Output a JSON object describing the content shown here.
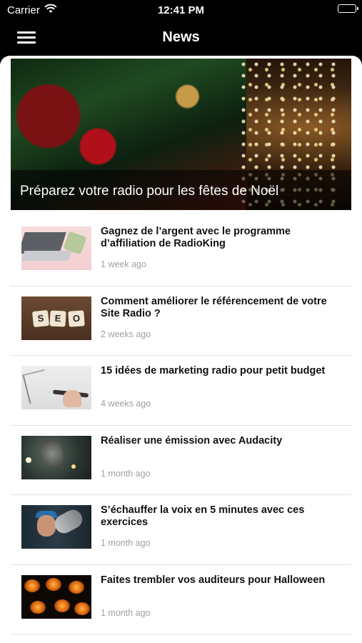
{
  "status_bar": {
    "carrier": "Carrier",
    "time": "12:41 PM",
    "wifi_icon": "wifi-icon",
    "battery_icon": "battery-icon"
  },
  "nav": {
    "title": "News",
    "menu_icon": "hamburger-menu-icon"
  },
  "hero": {
    "title": "Préparez votre radio pour les fêtes de Noël"
  },
  "articles": [
    {
      "title": "Gagnez de l’argent avec le programme d’affiliation de RadioKing",
      "time": "1 week ago"
    },
    {
      "title": "Comment améliorer le référencement de votre Site Radio ?",
      "time": "2 weeks ago"
    },
    {
      "title": "15 idées de marketing radio pour petit budget",
      "time": "4 weeks ago"
    },
    {
      "title": "Réaliser une émission avec Audacity",
      "time": "1 month ago"
    },
    {
      "title": "S’échauffer la voix en 5 minutes avec ces exercices",
      "time": "1 month ago"
    },
    {
      "title": "Faites trembler vos auditeurs pour Halloween",
      "time": "1 month ago"
    }
  ],
  "seo_tiles": [
    "S",
    "E",
    "O"
  ],
  "colors": {
    "nav_background": "#000000",
    "content_background": "#ffffff",
    "timestamp": "#a0a0a0",
    "separator": "#e1e1e1"
  }
}
